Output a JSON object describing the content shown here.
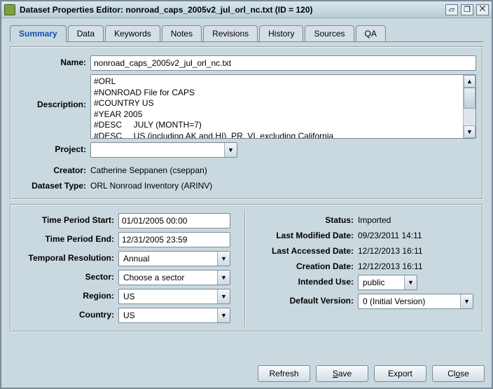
{
  "window": {
    "title": "Dataset Properties Editor: nonroad_caps_2005v2_jul_orl_nc.txt (ID = 120)"
  },
  "tabs": [
    "Summary",
    "Data",
    "Keywords",
    "Notes",
    "Revisions",
    "History",
    "Sources",
    "QA"
  ],
  "labels": {
    "name": "Name:",
    "description": "Description:",
    "project": "Project:",
    "creator": "Creator:",
    "datasetType": "Dataset Type:",
    "timePeriodStart": "Time Period Start:",
    "timePeriodEnd": "Time Period End:",
    "temporalResolution": "Temporal Resolution:",
    "sector": "Sector:",
    "region": "Region:",
    "country": "Country:",
    "status": "Status:",
    "lastModifiedDate": "Last Modified Date:",
    "lastAccessedDate": "Last Accessed Date:",
    "creationDate": "Creation Date:",
    "intendedUse": "Intended Use:",
    "defaultVersion": "Default Version:"
  },
  "fields": {
    "name": "nonroad_caps_2005v2_jul_orl_nc.txt",
    "description": "#ORL\n#NONROAD File for CAPS\n#COUNTRY US\n#YEAR 2005\n#DESC     JULY (MONTH=7)\n#DESC     US (including AK and HI), PR, VI, excluding California",
    "project": "",
    "creator": "Catherine Seppanen (cseppan)",
    "datasetType": "ORL Nonroad Inventory (ARINV)",
    "timePeriodStart": "01/01/2005 00:00",
    "timePeriodEnd": "12/31/2005 23:59",
    "temporalResolution": "Annual",
    "sector": "Choose a sector",
    "region": "US",
    "country": "US",
    "status": "Imported",
    "lastModifiedDate": "09/23/2011 14:11",
    "lastAccessedDate": "12/12/2013 16:11",
    "creationDate": "12/12/2013 16:11",
    "intendedUse": "public",
    "defaultVersion": "0 (Initial Version)"
  },
  "buttons": {
    "refresh": "Refresh",
    "save": "Save",
    "export": "Export",
    "close": "Close"
  }
}
